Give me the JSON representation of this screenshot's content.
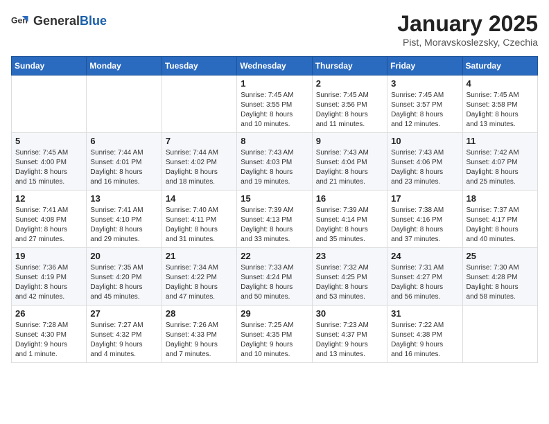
{
  "logo": {
    "general": "General",
    "blue": "Blue"
  },
  "header": {
    "month": "January 2025",
    "location": "Pist, Moravskoslezsky, Czechia"
  },
  "weekdays": [
    "Sunday",
    "Monday",
    "Tuesday",
    "Wednesday",
    "Thursday",
    "Friday",
    "Saturday"
  ],
  "weeks": [
    [
      {
        "day": "",
        "info": ""
      },
      {
        "day": "",
        "info": ""
      },
      {
        "day": "",
        "info": ""
      },
      {
        "day": "1",
        "info": "Sunrise: 7:45 AM\nSunset: 3:55 PM\nDaylight: 8 hours\nand 10 minutes."
      },
      {
        "day": "2",
        "info": "Sunrise: 7:45 AM\nSunset: 3:56 PM\nDaylight: 8 hours\nand 11 minutes."
      },
      {
        "day": "3",
        "info": "Sunrise: 7:45 AM\nSunset: 3:57 PM\nDaylight: 8 hours\nand 12 minutes."
      },
      {
        "day": "4",
        "info": "Sunrise: 7:45 AM\nSunset: 3:58 PM\nDaylight: 8 hours\nand 13 minutes."
      }
    ],
    [
      {
        "day": "5",
        "info": "Sunrise: 7:45 AM\nSunset: 4:00 PM\nDaylight: 8 hours\nand 15 minutes."
      },
      {
        "day": "6",
        "info": "Sunrise: 7:44 AM\nSunset: 4:01 PM\nDaylight: 8 hours\nand 16 minutes."
      },
      {
        "day": "7",
        "info": "Sunrise: 7:44 AM\nSunset: 4:02 PM\nDaylight: 8 hours\nand 18 minutes."
      },
      {
        "day": "8",
        "info": "Sunrise: 7:43 AM\nSunset: 4:03 PM\nDaylight: 8 hours\nand 19 minutes."
      },
      {
        "day": "9",
        "info": "Sunrise: 7:43 AM\nSunset: 4:04 PM\nDaylight: 8 hours\nand 21 minutes."
      },
      {
        "day": "10",
        "info": "Sunrise: 7:43 AM\nSunset: 4:06 PM\nDaylight: 8 hours\nand 23 minutes."
      },
      {
        "day": "11",
        "info": "Sunrise: 7:42 AM\nSunset: 4:07 PM\nDaylight: 8 hours\nand 25 minutes."
      }
    ],
    [
      {
        "day": "12",
        "info": "Sunrise: 7:41 AM\nSunset: 4:08 PM\nDaylight: 8 hours\nand 27 minutes."
      },
      {
        "day": "13",
        "info": "Sunrise: 7:41 AM\nSunset: 4:10 PM\nDaylight: 8 hours\nand 29 minutes."
      },
      {
        "day": "14",
        "info": "Sunrise: 7:40 AM\nSunset: 4:11 PM\nDaylight: 8 hours\nand 31 minutes."
      },
      {
        "day": "15",
        "info": "Sunrise: 7:39 AM\nSunset: 4:13 PM\nDaylight: 8 hours\nand 33 minutes."
      },
      {
        "day": "16",
        "info": "Sunrise: 7:39 AM\nSunset: 4:14 PM\nDaylight: 8 hours\nand 35 minutes."
      },
      {
        "day": "17",
        "info": "Sunrise: 7:38 AM\nSunset: 4:16 PM\nDaylight: 8 hours\nand 37 minutes."
      },
      {
        "day": "18",
        "info": "Sunrise: 7:37 AM\nSunset: 4:17 PM\nDaylight: 8 hours\nand 40 minutes."
      }
    ],
    [
      {
        "day": "19",
        "info": "Sunrise: 7:36 AM\nSunset: 4:19 PM\nDaylight: 8 hours\nand 42 minutes."
      },
      {
        "day": "20",
        "info": "Sunrise: 7:35 AM\nSunset: 4:20 PM\nDaylight: 8 hours\nand 45 minutes."
      },
      {
        "day": "21",
        "info": "Sunrise: 7:34 AM\nSunset: 4:22 PM\nDaylight: 8 hours\nand 47 minutes."
      },
      {
        "day": "22",
        "info": "Sunrise: 7:33 AM\nSunset: 4:24 PM\nDaylight: 8 hours\nand 50 minutes."
      },
      {
        "day": "23",
        "info": "Sunrise: 7:32 AM\nSunset: 4:25 PM\nDaylight: 8 hours\nand 53 minutes."
      },
      {
        "day": "24",
        "info": "Sunrise: 7:31 AM\nSunset: 4:27 PM\nDaylight: 8 hours\nand 56 minutes."
      },
      {
        "day": "25",
        "info": "Sunrise: 7:30 AM\nSunset: 4:28 PM\nDaylight: 8 hours\nand 58 minutes."
      }
    ],
    [
      {
        "day": "26",
        "info": "Sunrise: 7:28 AM\nSunset: 4:30 PM\nDaylight: 9 hours\nand 1 minute."
      },
      {
        "day": "27",
        "info": "Sunrise: 7:27 AM\nSunset: 4:32 PM\nDaylight: 9 hours\nand 4 minutes."
      },
      {
        "day": "28",
        "info": "Sunrise: 7:26 AM\nSunset: 4:33 PM\nDaylight: 9 hours\nand 7 minutes."
      },
      {
        "day": "29",
        "info": "Sunrise: 7:25 AM\nSunset: 4:35 PM\nDaylight: 9 hours\nand 10 minutes."
      },
      {
        "day": "30",
        "info": "Sunrise: 7:23 AM\nSunset: 4:37 PM\nDaylight: 9 hours\nand 13 minutes."
      },
      {
        "day": "31",
        "info": "Sunrise: 7:22 AM\nSunset: 4:38 PM\nDaylight: 9 hours\nand 16 minutes."
      },
      {
        "day": "",
        "info": ""
      }
    ]
  ]
}
